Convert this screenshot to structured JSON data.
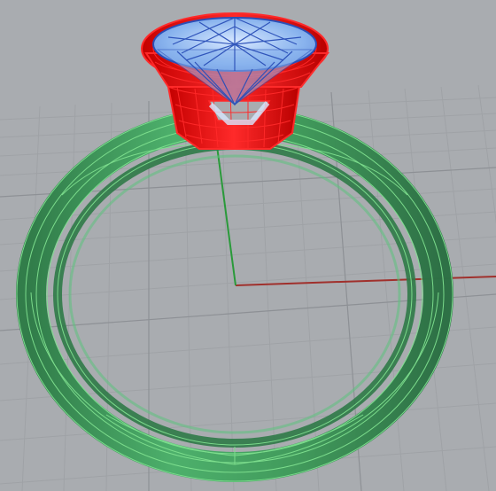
{
  "viewport": {
    "background": "#a9acb0",
    "grid_minor_color": "#9ea1a5",
    "grid_major_color": "#8d9095",
    "x_axis_color": "#a0302c",
    "y_axis_color": "#2a9a3a"
  },
  "objects": {
    "ring_shank": {
      "name": "ring-shank",
      "color": "#3d9a5a",
      "edge_color": "#7fe08f",
      "selected": false
    },
    "bezel_setting": {
      "name": "bezel-setting",
      "color": "#e00000",
      "edge_color": "#ff2a2a",
      "selected": true
    },
    "gemstone": {
      "name": "gemstone",
      "color": "#8ab4ee",
      "edge_color": "#2a4fb8",
      "selected": false
    }
  }
}
